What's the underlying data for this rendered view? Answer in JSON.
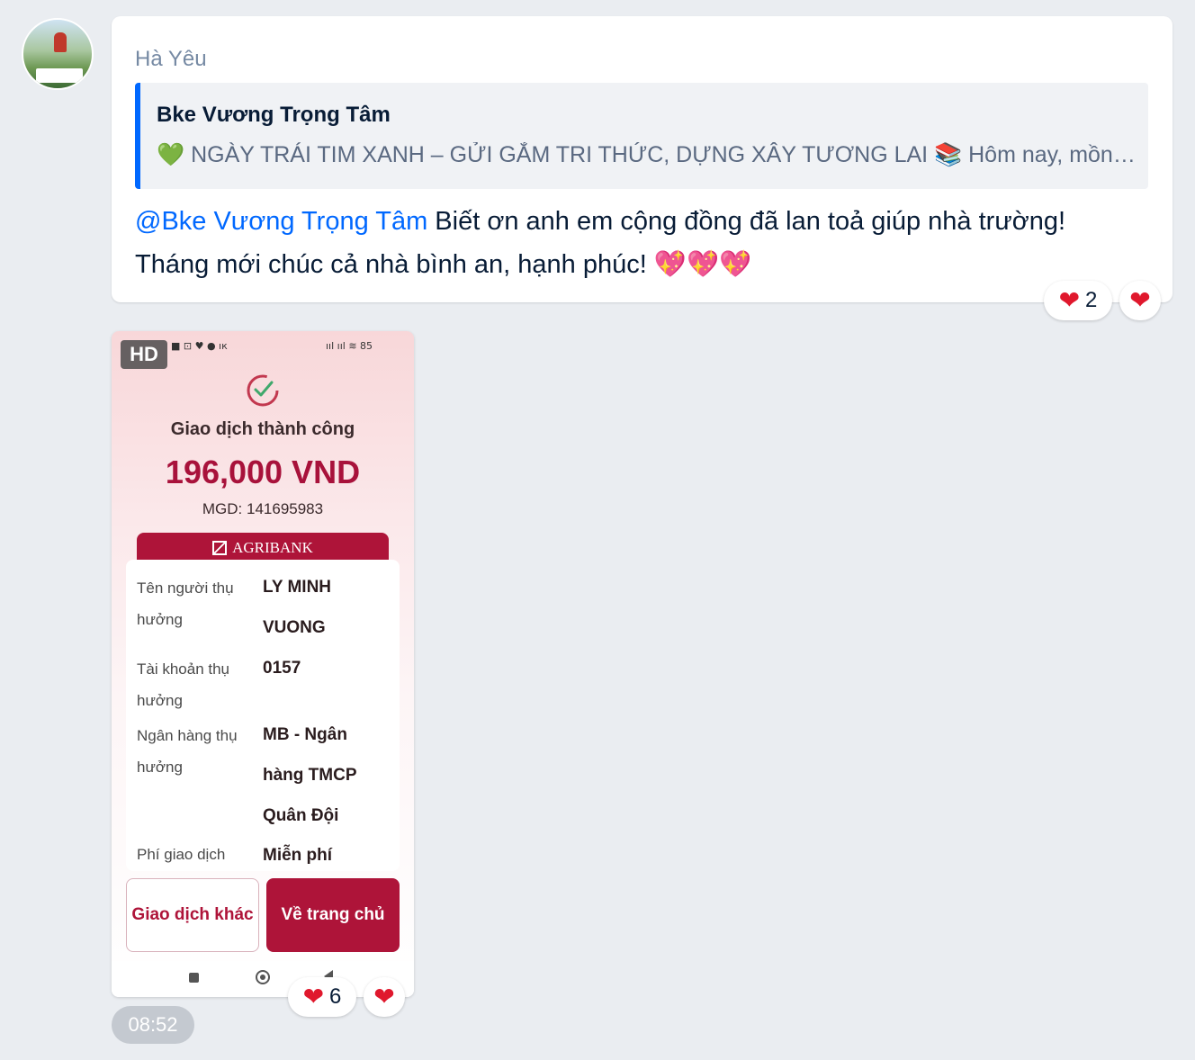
{
  "message": {
    "sender": "Hà Yêu",
    "quote": {
      "name": "Bke Vương Trọng Tâm",
      "text": "💚 NGÀY TRÁI TIM XANH – GỬI GẮM TRI THỨC, DỰNG XÂY TƯƠNG LAI 📚 Hôm nay, mồng ..."
    },
    "mention": "@Bke Vương Trọng Tâm",
    "text_line1": " Biết ơn anh em cộng đồng đã lan toả giúp nhà trường!",
    "text_line2": "Tháng mới chúc cả nhà bình an, hạnh phúc! 💖💖💖",
    "reaction_count": "2"
  },
  "image": {
    "hd_badge": "HD",
    "status_left": "■ ⊡ ♥ ● ıк",
    "status_right": "ııl ııl ≋ 85",
    "success_title": "Giao dịch thành công",
    "amount": "196,000 VND",
    "mgd": "MGD: 141695983",
    "bank_name": "AGRIBANK",
    "details": [
      {
        "label": "Tên người thụ hưởng",
        "value": "LY MINH VUONG"
      },
      {
        "label": "Tài khoản thụ hưởng",
        "value": "0157"
      },
      {
        "label": "Ngân hàng thụ hưởng",
        "value": "MB - Ngân hàng TMCP Quân Đội"
      },
      {
        "label": "Phí giao dịch",
        "value": "Miễn phí"
      }
    ],
    "btn_other": "Giao dịch khác",
    "btn_home": "Về trang chủ",
    "reaction_count": "6"
  },
  "time": "08:52",
  "icons": {
    "reaction": "heart-icon",
    "success": "check-circle-icon",
    "bank": "agribank-logo-icon"
  },
  "colors": {
    "mention": "#0068ff",
    "quote_bar": "#0068ff",
    "bank_red": "#ae1439",
    "heart": "#e0182d"
  }
}
